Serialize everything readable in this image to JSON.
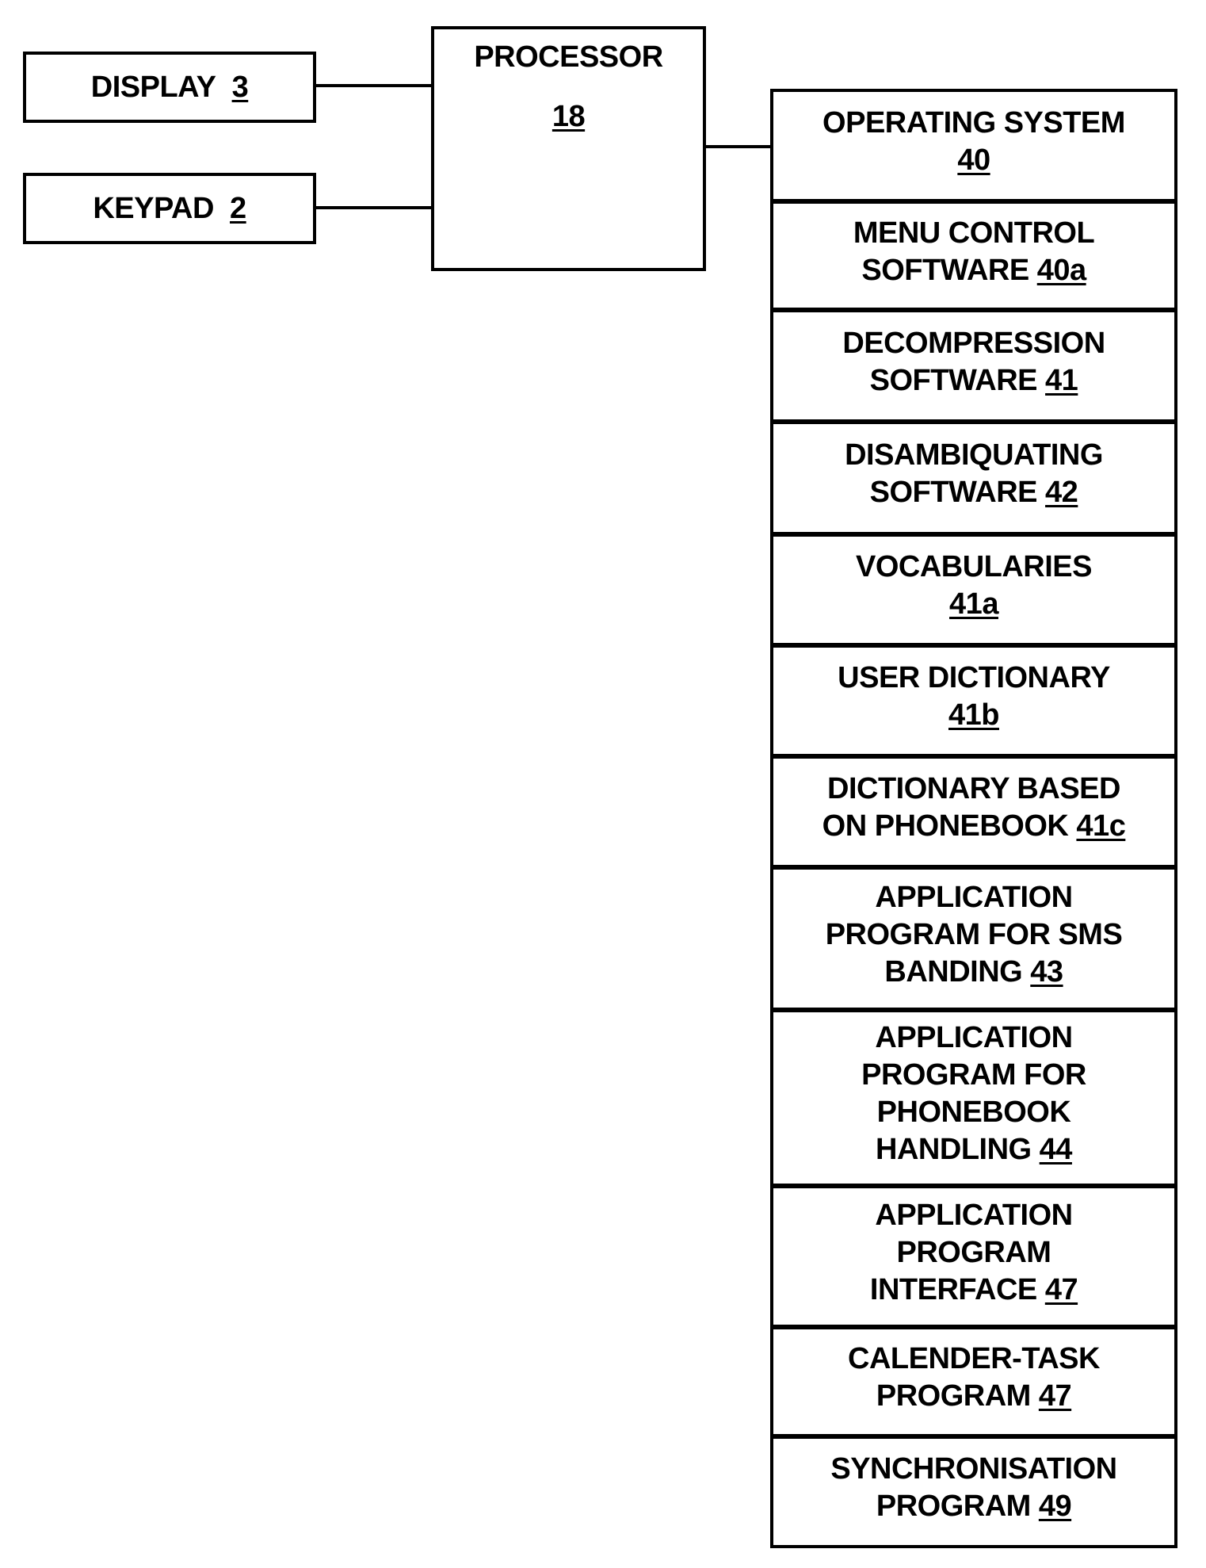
{
  "left_boxes": [
    {
      "label": "DISPLAY",
      "ref": "3"
    },
    {
      "label": "KEYPAD",
      "ref": "2"
    }
  ],
  "processor": {
    "label": "PROCESSOR",
    "ref": "18"
  },
  "software_stack": [
    {
      "label": "OPERATING SYSTEM\n",
      "ref": "40"
    },
    {
      "label": "MENU CONTROL\nSOFTWARE ",
      "ref": "40a"
    },
    {
      "label": "DECOMPRESSION\nSOFTWARE ",
      "ref": "41"
    },
    {
      "label": "DISAMBIQUATING\nSOFTWARE ",
      "ref": "42"
    },
    {
      "label": "VOCABULARIES\n",
      "ref": "41a"
    },
    {
      "label": "USER DICTIONARY\n",
      "ref": "41b"
    },
    {
      "label": "DICTIONARY BASED\nON PHONEBOOK ",
      "ref": "41c"
    },
    {
      "label": "APPLICATION\nPROGRAM FOR SMS\nBANDING ",
      "ref": "43"
    },
    {
      "label": "APPLICATION\nPROGRAM FOR\nPHONEBOOK\nHANDLING ",
      "ref": "44"
    },
    {
      "label": "APPLICATION\nPROGRAM\nINTERFACE ",
      "ref": "47"
    },
    {
      "label": "CALENDER-TASK\nPROGRAM  ",
      "ref": "47"
    },
    {
      "label": "SYNCHRONISATION\nPROGRAM  ",
      "ref": "49"
    }
  ]
}
